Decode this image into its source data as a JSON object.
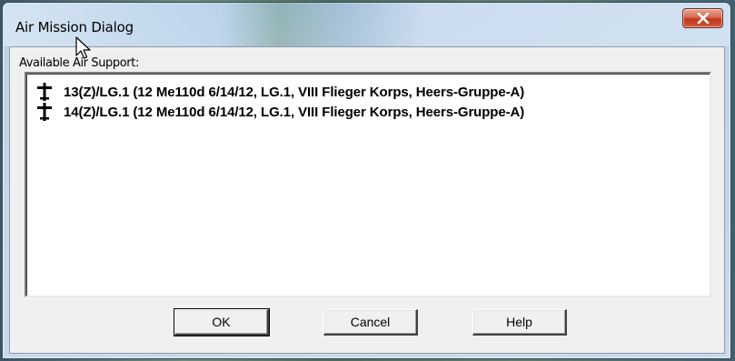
{
  "window": {
    "title": "Air Mission Dialog",
    "close_icon": "close-icon"
  },
  "dialog": {
    "available_label": "Available Air Support:",
    "air_units": [
      {
        "icon": "plane-icon",
        "label": "13(Z)/LG.1 (12 Me110d 6/14/12, LG.1, VIII Flieger Korps, Heers-Gruppe-A)"
      },
      {
        "icon": "plane-icon",
        "label": "14(Z)/LG.1 (12 Me110d 6/14/12, LG.1, VIII Flieger Korps, Heers-Gruppe-A)"
      }
    ]
  },
  "buttons": {
    "ok": "OK",
    "cancel": "Cancel",
    "help": "Help"
  },
  "colors": {
    "title_glass": "#b9d1ea",
    "close_red": "#c1361b",
    "dialog_face": "#f0f0f0",
    "list_bg": "#ffffff"
  }
}
